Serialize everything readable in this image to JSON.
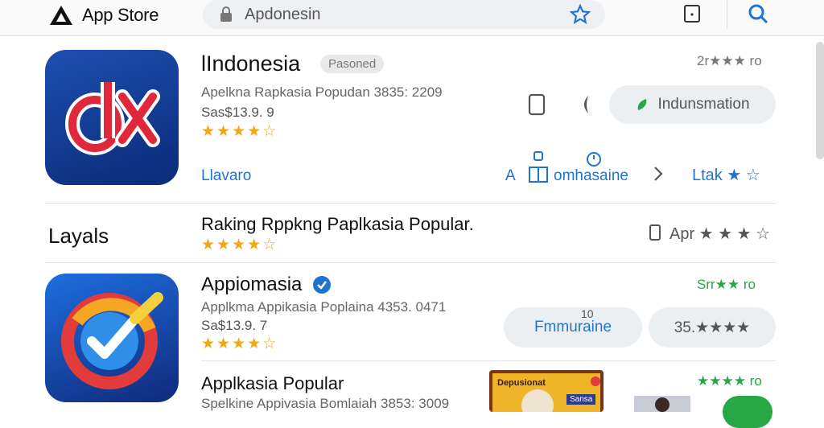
{
  "header": {
    "brand": "App Store",
    "search_value": "Apdonesin"
  },
  "apps": [
    {
      "title": "lIndonesia",
      "badge": "Pasoned",
      "subtitle": "Apelkna Rapkasia Popudan 3835: 2209",
      "price": "Sas$13.9. 9",
      "stars": "★★★★☆",
      "link": "Llavaro",
      "rating_text": "2r★★★ ro",
      "get_button": "Indunsmation",
      "action_a": "A",
      "action_label": "omhasaine",
      "action_right": "Ltak ★ ☆"
    },
    {
      "title": "Appiomasia",
      "subtitle": "Applkma Appikasia Poplaina 4353. 0471",
      "price": "Sa$13.9. 7",
      "stars": "★★★★☆",
      "rating_text": "Srr★★ ro",
      "pill_label": "Fmmuraine",
      "pill_small": "10",
      "pill_rating": "35.★★★★"
    },
    {
      "title": "Applkasia Popular",
      "subtitle": "Spelkine Appivasia Bomlaiah 3853: 3009",
      "rating_text": "★★★★ ro",
      "thumb_title": "Depusionat",
      "thumb_caption": "Sansa"
    }
  ],
  "section": {
    "label": "Layals",
    "heading": "Raking Rppkng Paplkasia Popular.",
    "stars": "★★★★☆",
    "rating_text": "Apr ★ ★ ★ ☆"
  },
  "colors": {
    "accent": "#1e74d0",
    "green": "#27a844",
    "star": "#f2a712"
  }
}
